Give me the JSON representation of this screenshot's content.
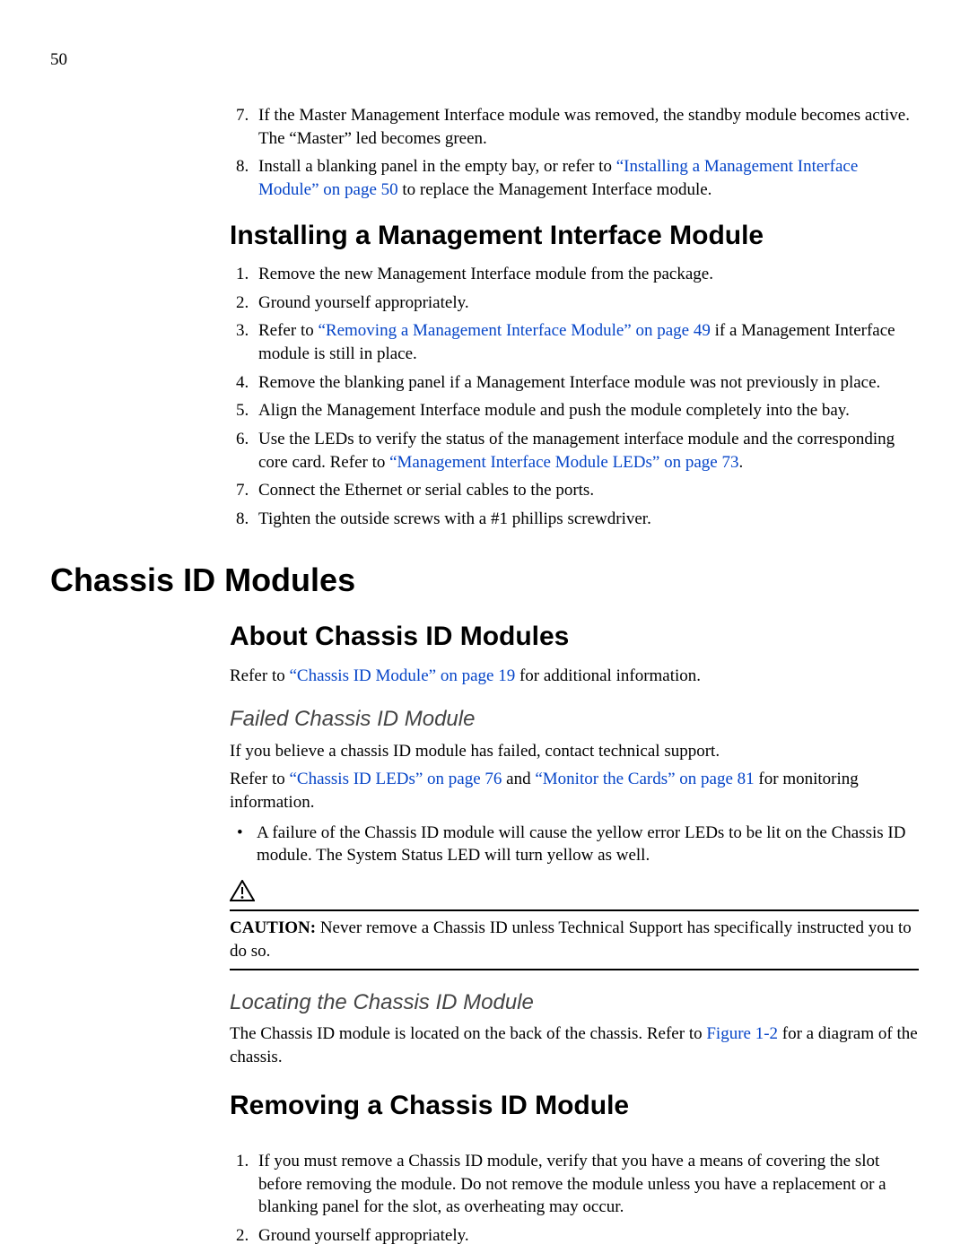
{
  "page_number": "50",
  "top_list": {
    "item7": "If the Master Management Interface module was removed, the standby module becomes active. The “Master” led becomes green.",
    "item8_a": "Install a blanking panel in the empty bay, or refer to ",
    "item8_link": "“Installing a Management Interface Module” on page 50",
    "item8_b": " to replace the Management Interface module."
  },
  "h2_install": "Installing a Management Interface Module",
  "install_list": {
    "i1": "Remove the new Management Interface module from the package.",
    "i2": "Ground yourself appropriately.",
    "i3_a": "Refer to ",
    "i3_link": "“Removing a Management Interface Module” on page 49",
    "i3_b": " if a Management Interface module is still in place.",
    "i4": "Remove the blanking panel if a Management Interface module was not previously in place.",
    "i5": "Align the Management Interface module and push the module completely into the bay.",
    "i6_a": "Use the LEDs to verify the status of the management interface module and the corresponding core card. Refer to ",
    "i6_link": "“Management Interface Module LEDs” on page 73",
    "i6_b": ".",
    "i7": "Connect the Ethernet or serial cables to the ports.",
    "i8": "Tighten the outside screws with a #1 phillips screwdriver."
  },
  "h1_chassis": "Chassis ID Modules",
  "h2_about": "About Chassis ID Modules",
  "about": {
    "p1_a": "Refer to ",
    "p1_link": "“Chassis ID Module” on page 19",
    "p1_b": " for additional information."
  },
  "h3_failed": "Failed Chassis ID Module",
  "failed": {
    "p1": "If you believe a chassis ID module has failed, contact technical support.",
    "p2_a": "Refer to ",
    "p2_link1": "“Chassis ID LEDs” on page 76",
    "p2_mid": " and ",
    "p2_link2": "“Monitor the Cards” on page 81",
    "p2_b": " for monitoring information.",
    "bullet": "A failure of the Chassis ID module will cause the yellow error LEDs to be lit on the Chassis ID module. The System Status LED will turn yellow as well."
  },
  "caution": {
    "label": "CAUTION:",
    "text": "  Never remove a Chassis ID unless Technical Support has specifically instructed you to do so."
  },
  "h3_locating": "Locating the Chassis ID Module",
  "locating": {
    "p_a": "The Chassis ID module is located on the back of the chassis. Refer to ",
    "p_link": "Figure 1-2",
    "p_b": " for a diagram of the chassis."
  },
  "h2_removing": "Removing a Chassis ID Module",
  "removing_list": {
    "i1": "If you must remove a Chassis ID module, verify that you have a means of covering the slot before removing the module. Do not remove the module unless you have a replacement or a blanking panel for the slot, as overheating may occur.",
    "i2": "Ground yourself appropriately."
  }
}
